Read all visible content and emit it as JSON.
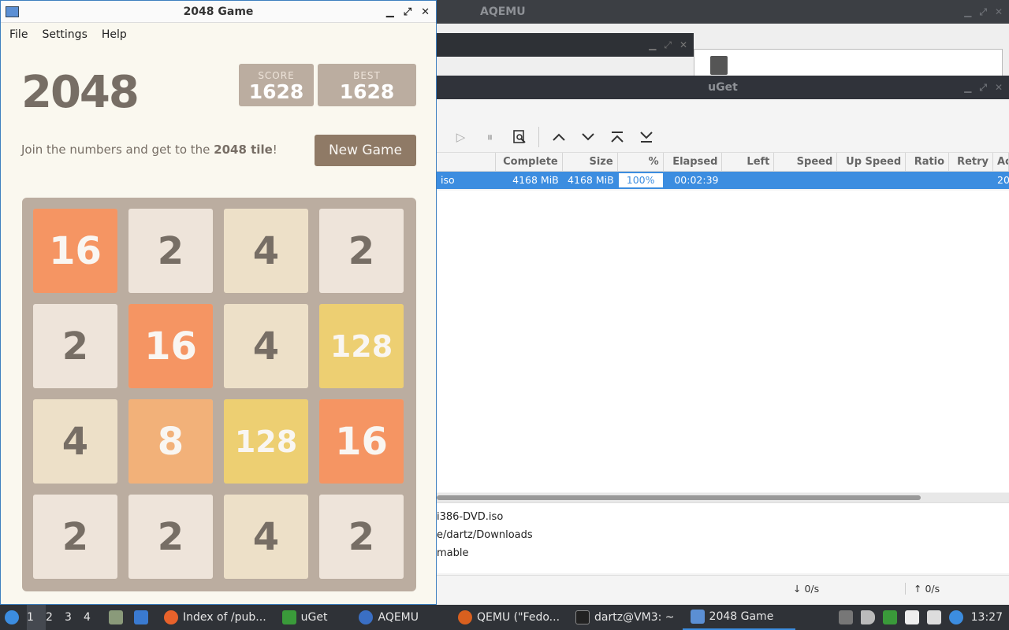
{
  "aqemu": {
    "title": "AQEMU"
  },
  "uget": {
    "title": "uGet",
    "columns": [
      "Complete",
      "Size",
      "%",
      "Elapsed",
      "Left",
      "Speed",
      "Up Speed",
      "Ratio",
      "Retry",
      "Ac"
    ],
    "row": {
      "name": "iso",
      "complete": "4168 MiB",
      "size": "4168 MiB",
      "percent": "100%",
      "elapsed": "00:02:39",
      "left": "",
      "speed": "",
      "up_speed": "",
      "ratio": "",
      "retry": "",
      "added": "20"
    },
    "details": [
      "i386-DVD.iso",
      "e/dartz/Downloads",
      "mable"
    ],
    "status": {
      "down": "↓ 0/s",
      "up": "↑ 0/s"
    }
  },
  "game": {
    "window_title": "2048 Game",
    "menu": [
      "File",
      "Settings",
      "Help"
    ],
    "heading": "2048",
    "score_label": "SCORE",
    "score": "1628",
    "best_label": "BEST",
    "best": "1628",
    "intro_prefix": "Join the numbers and get to the ",
    "intro_bold": "2048 tile",
    "intro_suffix": "!",
    "new_game": "New Game",
    "grid": [
      [
        "16",
        "2",
        "4",
        "2"
      ],
      [
        "2",
        "16",
        "4",
        "128"
      ],
      [
        "4",
        "8",
        "128",
        "16"
      ],
      [
        "2",
        "2",
        "4",
        "2"
      ]
    ],
    "tile_colors": {
      "2": {
        "bg": "#eee4da",
        "fg": "#776e65"
      },
      "4": {
        "bg": "#ede0c8",
        "fg": "#776e65"
      },
      "8": {
        "bg": "#f2b179",
        "fg": "#f9f6f2"
      },
      "16": {
        "bg": "#f59563",
        "fg": "#f9f6f2"
      },
      "128": {
        "bg": "#edcf72",
        "fg": "#f9f6f2"
      }
    }
  },
  "taskbar": {
    "workspaces": [
      "1",
      "2",
      "3",
      "4"
    ],
    "tasks": [
      "Index of /pub...",
      "uGet",
      "AQEMU",
      "QEMU (\"Fedo...",
      "dartz@VM3: ~",
      "2048 Game"
    ],
    "clock": "13:27"
  }
}
